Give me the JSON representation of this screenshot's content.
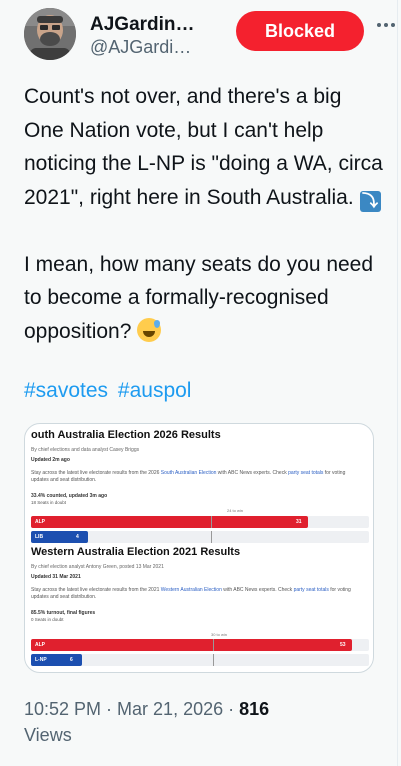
{
  "author": {
    "name": "AJGardin…",
    "handle": "@AJGardi…",
    "blocked_label": "Blocked",
    "more_icon": "more-horizontal-icon"
  },
  "tweet": {
    "text_part1": "Count's not over, and there's a big One Nation vote, but I can't help noticing the L-NP is \"doing a WA, circa 2021\", right here in South Australia. ",
    "text_part2": "\n\nI mean, how many seats do you need to become a formally-recognised opposition? ",
    "hashtag1": "#savotes",
    "hashtag2": "#auspol"
  },
  "media": {
    "sa": {
      "title": "outh Australia Election 2026 Results",
      "byline": "By chief elections and data analyst Casey Briggs",
      "updated": "Updated 2m ago",
      "desc_before": "Stay across the latest live electorate results from the 2026 ",
      "desc_link1": "South Australian Election",
      "desc_mid": " with ABC News experts. Check ",
      "desc_link2": "party seat totals",
      "desc_after": " for voting updates and seat distribution.",
      "counted": "33.4% counted, updated 3m ago",
      "doubt": "18 Seats in doubt",
      "win_label": "24 to win",
      "bars": [
        {
          "party": "ALP",
          "seats": 31,
          "color": "#e0202e",
          "fraction": 0.82
        },
        {
          "party": "LIB",
          "seats": 4,
          "color": "#1c4fb0",
          "fraction": 0.17
        }
      ]
    },
    "wa": {
      "title": "Western Australia Election 2021 Results",
      "byline": "By chief election analyst Antony Green, posted 13 Mar 2021",
      "updated": "Updated 31 Mar 2021",
      "desc_before": "Stay across the latest live electorate results from the 2021 ",
      "desc_link1": "Western Australian Election",
      "desc_mid": " with ABC News experts. Check ",
      "desc_link2": "party seat totals",
      "desc_after": " for voting updates and seat distribution.",
      "counted": "85.5% turnout, final figures",
      "doubt": "0 Seats in doubt",
      "win_label": "30 to win",
      "bars": [
        {
          "party": "ALP",
          "seats": 53,
          "color": "#e0202e",
          "fraction": 0.95
        },
        {
          "party": "L-NP",
          "seats": 6,
          "color": "#1c4fb0",
          "fraction": 0.15
        }
      ]
    }
  },
  "footer": {
    "timestamp": "10:52 PM · Mar 21, 2026 · ",
    "views_count": "816",
    "views_label": "Views"
  }
}
